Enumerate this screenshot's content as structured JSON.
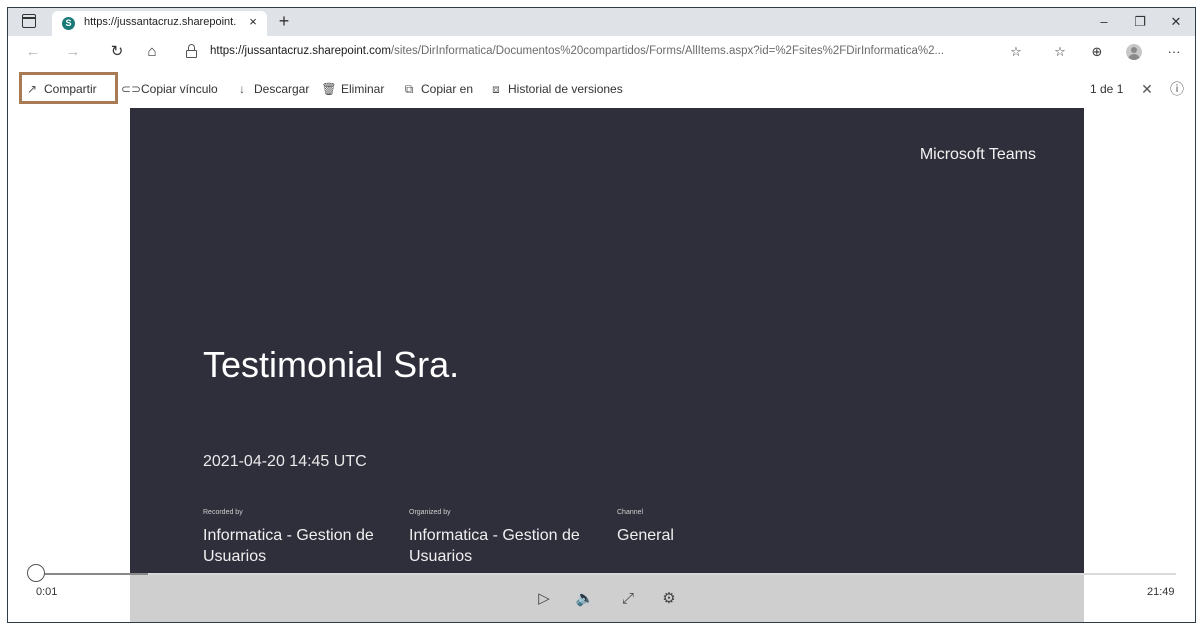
{
  "browser": {
    "tab_title": "https://jussantacruz.sharepoint.c",
    "tab_close": "×",
    "new_tab": "+",
    "favicon_letter": "S",
    "window": {
      "minimize": "–",
      "restore": "❐",
      "close": "✕"
    },
    "url_host": "https://jussantacruz.sharepoint.com",
    "url_path": "/sites/DirInformatica/Documentos%20compartidos/Forms/AllItems.aspx?id=%2Fsites%2FDirInformatica%2...",
    "nav": {
      "back": "←",
      "forward": "→",
      "refresh": "↻",
      "home": "⌂"
    },
    "addr_icons": {
      "read_aloud": "☆",
      "favorites": "☆",
      "collections": "⊕",
      "more": "···"
    }
  },
  "commandbar": {
    "share": "Compartir",
    "copy_link": "Copiar vínculo",
    "download": "Descargar",
    "delete": "Eliminar",
    "copy_to": "Copiar en",
    "version_history": "Historial de versiones",
    "pager": "1 de 1",
    "close": "✕",
    "info": "ⓘ"
  },
  "video": {
    "brand": "Microsoft Teams",
    "title": "Testimonial Sra.",
    "date": "2021-04-20 14:45 UTC",
    "meta": [
      {
        "label": "Recorded by",
        "value": "Informatica - Gestion de Usuarios"
      },
      {
        "label": "Organized by",
        "value": "Informatica - Gestion de Usuarios"
      },
      {
        "label": "Channel",
        "value": "General"
      }
    ]
  },
  "player": {
    "current_time": "0:01",
    "duration": "21:49",
    "progress_fraction": 0.0008,
    "controls": {
      "play": "▷",
      "volume": "🔈",
      "fullscreen": "⤢",
      "settings": "⚙"
    }
  },
  "colors": {
    "video_bg": "#2f2e3b",
    "highlight": "#a97b54",
    "tabbar": "#dfe3e8"
  }
}
